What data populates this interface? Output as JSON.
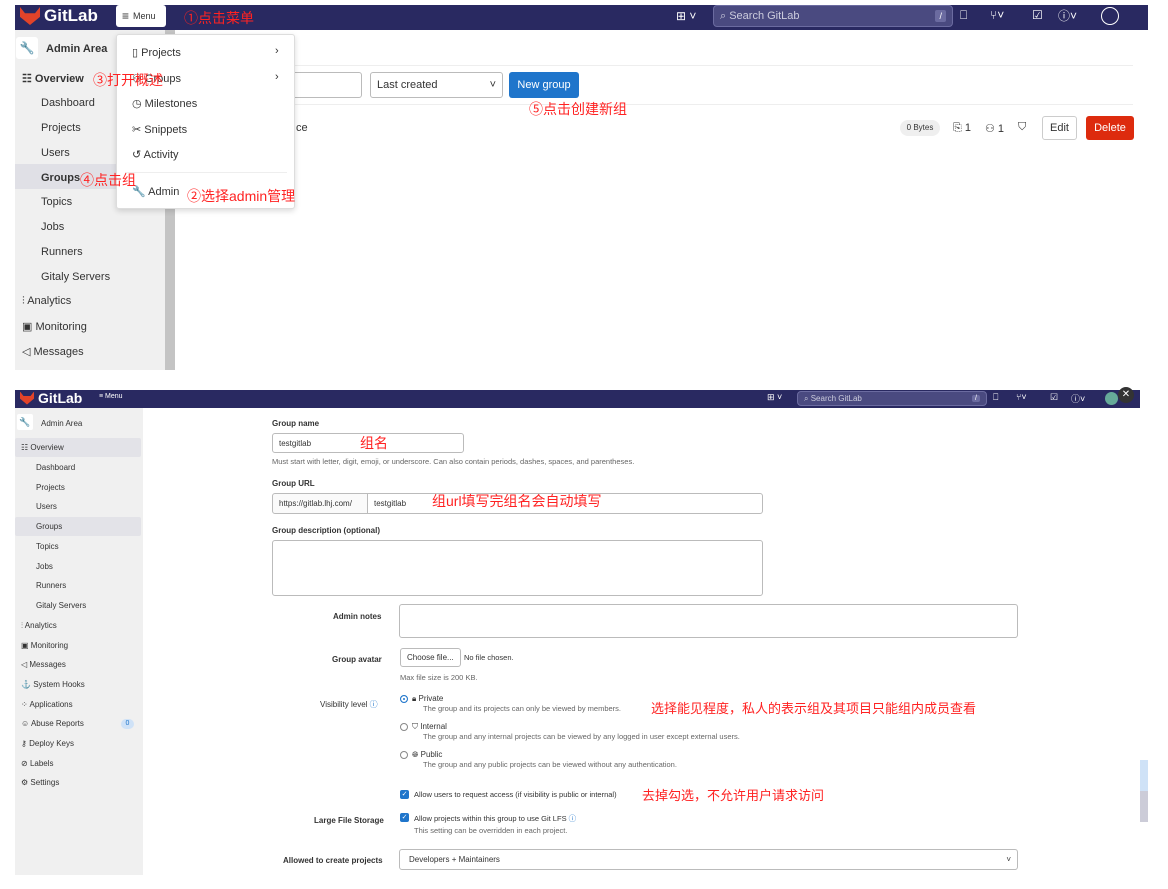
{
  "top": {
    "header": {
      "logo": "GitLab",
      "menu": "Menu",
      "search_placeholder": "Search GitLab",
      "slash": "/"
    },
    "annotations": [
      "①点击菜单",
      "②选择admin管理",
      "③打开概述",
      "④点击组",
      "⑤点击创建新组"
    ],
    "sidebar": {
      "title": "Admin Area",
      "items": [
        "Overview",
        "Dashboard",
        "Projects",
        "Users",
        "Groups",
        "Topics",
        "Jobs",
        "Runners",
        "Gitaly Servers",
        "Analytics",
        "Monitoring",
        "Messages"
      ]
    },
    "menu_dropdown": [
      "Projects",
      "Groups",
      "Milestones",
      "Snippets",
      "Activity",
      "Admin"
    ],
    "toolbar": {
      "sort": "Last created",
      "new_group": "New group"
    },
    "row": {
      "name_fragment": "ce",
      "size": "0 Bytes",
      "projects": "1",
      "members": "1",
      "edit": "Edit",
      "delete": "Delete"
    }
  },
  "bottom": {
    "header": {
      "logo": "GitLab",
      "menu": "Menu",
      "search_placeholder": "Search GitLab",
      "slash": "/"
    },
    "sidebar": {
      "title": "Admin Area",
      "items": [
        "Overview",
        "Dashboard",
        "Projects",
        "Users",
        "Groups",
        "Topics",
        "Jobs",
        "Runners",
        "Gitaly Servers",
        "Analytics",
        "Monitoring",
        "Messages",
        "System Hooks",
        "Applications",
        "Abuse Reports",
        "Deploy Keys",
        "Labels",
        "Settings"
      ],
      "abuse_count": "0"
    },
    "form": {
      "group_name_label": "Group name",
      "group_name": "testgitlab",
      "group_name_hint": "Must start with letter, digit, emoji, or underscore. Can also contain periods, dashes, spaces, and parentheses.",
      "group_url_label": "Group URL",
      "url_prefix": "https://gitlab.lhj.com/",
      "url_path": "testgitlab",
      "description_label": "Group description (optional)",
      "admin_notes_label": "Admin notes",
      "avatar_label": "Group avatar",
      "choose_file": "Choose file...",
      "no_file": "No file chosen.",
      "max_size": "Max file size is 200 KB.",
      "visibility_label": "Visibility level",
      "visibility": [
        {
          "name": "Private",
          "desc": "The group and its projects can only be viewed by members.",
          "selected": true
        },
        {
          "name": "Internal",
          "desc": "The group and any internal projects can be viewed by any logged in user except external users.",
          "selected": false
        },
        {
          "name": "Public",
          "desc": "The group and any public projects can be viewed without any authentication.",
          "selected": false
        }
      ],
      "request_access": "Allow users to request access (if visibility is public or internal)",
      "request_access_checked": true,
      "lfs_label": "Large File Storage",
      "lfs": "Allow projects within this group to use Git LFS",
      "lfs_checked": true,
      "lfs_hint": "This setting can be overridden in each project.",
      "create_projects_label": "Allowed to create projects",
      "create_projects": "Developers + Maintainers"
    },
    "annotations": [
      "组名",
      "组url填写完组名会自动填写",
      "选择能见程度，私人的表示组及其项目只能组内成员查看",
      "去掉勾选，不允许用户请求访问"
    ]
  },
  "colors": {
    "header": "#292961",
    "primary": "#1f75cb",
    "danger": "#dd2b0e",
    "annotation": "#ff2222"
  }
}
